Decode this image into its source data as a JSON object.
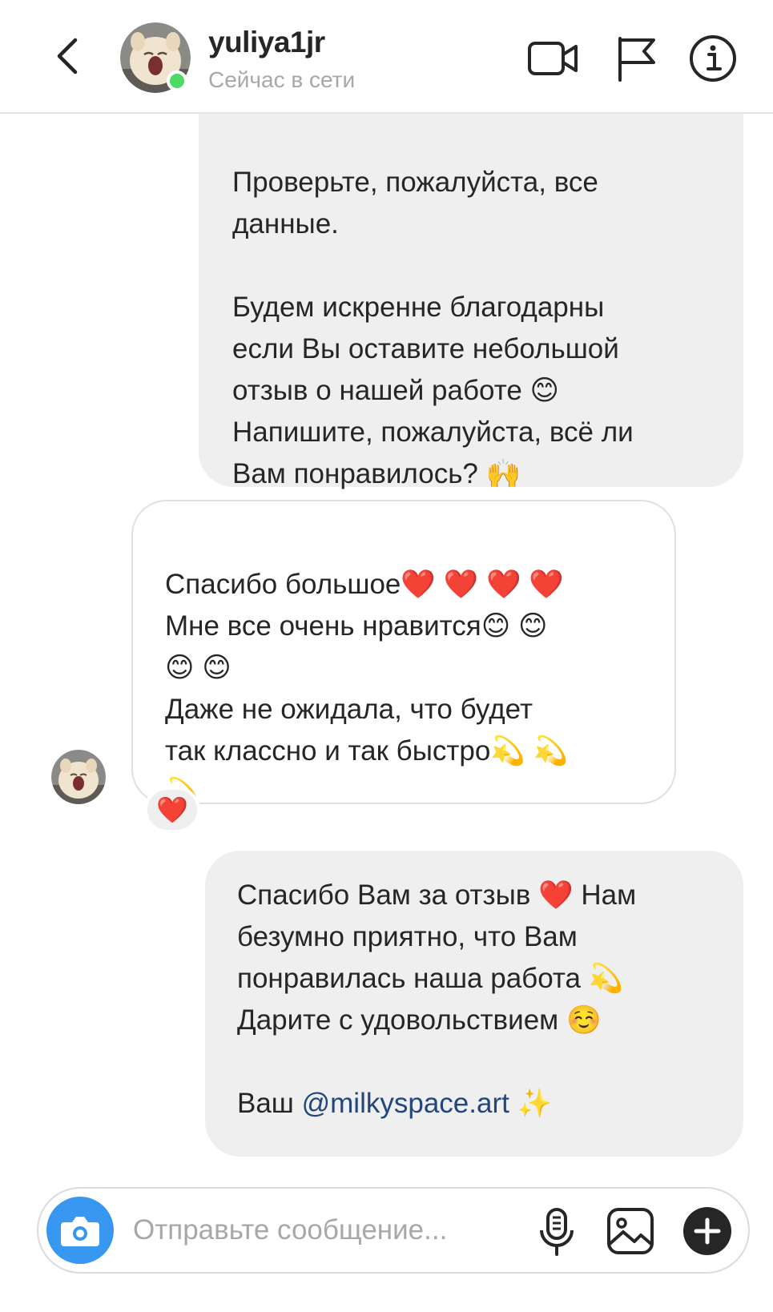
{
  "header": {
    "username": "yuliya1jr",
    "status": "Сейчас в сети",
    "back_icon": "chevron-left-icon",
    "actions": [
      "video-camera-icon",
      "flag-icon",
      "info-icon"
    ]
  },
  "messages": [
    {
      "direction": "outgoing",
      "text": "Проверьте, пожалуйста, все\nданные.\n\nБудем искренне благодарны\nесли Вы оставите небольшой\nотзыв о нашей работе 😊\nНапишите, пожалуйста, всё ли\nВам понравилось? 🙌"
    },
    {
      "direction": "incoming",
      "text": "Спасибо большое❤️ ❤️ ❤️ ❤️\nМне все очень нравится😊 😊\n😊 😊\nДаже не ожидала, что будет\nтак классно и так быстро💫 💫\n💫",
      "reaction": "❤️"
    },
    {
      "direction": "outgoing",
      "text": "Спасибо Вам за отзыв ❤️ Нам\nбезумно приятно, что Вам\nпонравилась наша работа 💫\nДарите с удовольствием ☺️\n\nВаш ",
      "mention": "@milkyspace.art",
      "suffix": " ✨"
    }
  ],
  "composer": {
    "placeholder": "Отправьте сообщение...",
    "value": "",
    "icons": [
      "camera-icon",
      "microphone-icon",
      "gallery-icon",
      "plus-icon"
    ]
  },
  "colors": {
    "accent_blue": "#3897f0",
    "online_green": "#4cd964",
    "outgoing_bubble": "#efefef",
    "mention": "#23467c",
    "placeholder": "#a8a8a8"
  }
}
